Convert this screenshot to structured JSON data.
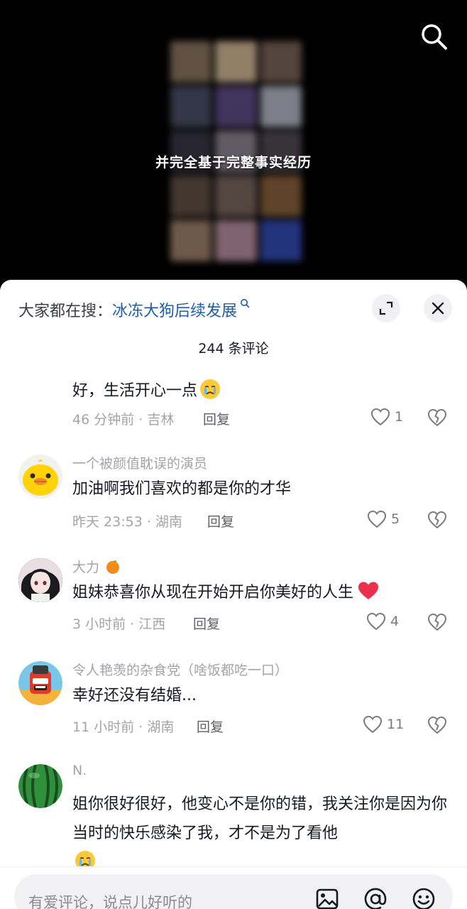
{
  "video": {
    "caption": "并完全基于完整事实经历"
  },
  "sheet": {
    "hot_search_prefix": "大家都在搜：",
    "hot_search_keyword": "冰冻大狗后续发展",
    "comment_count": "244 条评论"
  },
  "comments": [
    {
      "text": "好，生活开心一点",
      "time": "46 分钟前 · 吉林",
      "reply": "回复",
      "likes": "1"
    },
    {
      "user": "一个被颜值耽误的演员",
      "text": "加油啊我们喜欢的都是你的才华",
      "time": "昨天 23:53 · 湖南",
      "reply": "回复",
      "likes": "5"
    },
    {
      "user": "大力",
      "text": "姐妹恭喜你从现在开始开启你美好的人生",
      "time": "3 小时前 · 江西",
      "reply": "回复",
      "likes": "4"
    },
    {
      "user": "令人艳羡的杂食党（啥饭都吃一口）",
      "text": "幸好还没有结婚...",
      "time": "11 小时前 · 湖南",
      "reply": "回复",
      "likes": "11"
    },
    {
      "user": "N.",
      "text": "姐你很好很好，他变心不是你的错，我关注你是因为你当时的快乐感染了我，才不是为了看他"
    }
  ],
  "input": {
    "placeholder": "有爱评论，说点儿好听的"
  },
  "colors": {
    "link": "#1f5ea8",
    "muted": "#a3a4a9",
    "heart": "#e8314a"
  },
  "icons": [
    "search-icon",
    "expand-icon",
    "close-icon",
    "heart-outline-icon",
    "broken-heart-icon",
    "image-icon",
    "at-icon",
    "emoji-icon"
  ]
}
